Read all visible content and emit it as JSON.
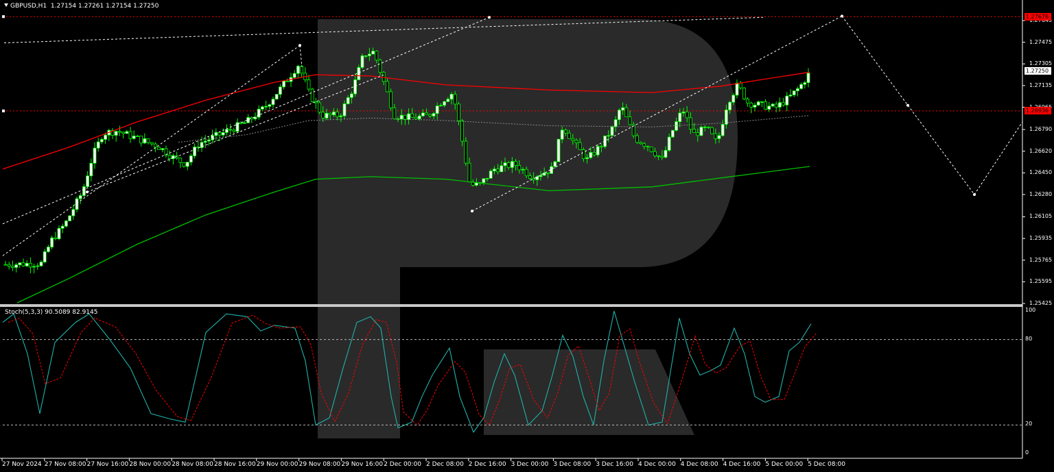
{
  "header": {
    "symbol": "GBPUSD,H1",
    "ohlc": "1.27154 1.27261 1.27154 1.27250"
  },
  "oscillator": {
    "label": "Stoch(5,3,3) 90.5089 82.9145",
    "scale": [
      "100",
      "80",
      "20",
      "0"
    ]
  },
  "price_axis": {
    "labels": [
      "1.27645",
      "1.27475",
      "1.27305",
      "1.27135",
      "1.26965",
      "1.26790",
      "1.26620",
      "1.26450",
      "1.26280",
      "1.26105",
      "1.25935",
      "1.25765",
      "1.25595",
      "1.25425"
    ],
    "tags": [
      {
        "value": "1.27676",
        "bg": "#ff0000",
        "fg": "#000000"
      },
      {
        "value": "1.27250",
        "bg": "#ffffff",
        "fg": "#000000"
      },
      {
        "value": "1.26936",
        "bg": "#ff0000",
        "fg": "#000000"
      }
    ]
  },
  "time_axis": {
    "labels": [
      "27 Nov 2024",
      "27 Nov 08:00",
      "27 Nov 16:00",
      "28 Nov 00:00",
      "28 Nov 08:00",
      "28 Nov 16:00",
      "29 Nov 00:00",
      "29 Nov 08:00",
      "29 Nov 16:00",
      "2 Dec 00:00",
      "2 Dec 08:00",
      "2 Dec 16:00",
      "3 Dec 00:00",
      "3 Dec 08:00",
      "3 Dec 16:00",
      "4 Dec 00:00",
      "4 Dec 08:00",
      "4 Dec 16:00",
      "5 Dec 00:00",
      "5 Dec 08:00"
    ]
  },
  "colors": {
    "background": "#000000",
    "bull_candle": "#ffffff",
    "bear_candle": "#000000",
    "wick": "#00ff00",
    "ma_red": "#ff0000",
    "ma_green": "#00c000",
    "stoch_main": "#20b2aa",
    "stoch_signal": "#ff0000",
    "level_lines": "#ff0000",
    "forecast": "#ffffff",
    "watermark": "#2b2b2b"
  },
  "levels": {
    "resistance": "1.27676",
    "support": "1.26936"
  }
}
